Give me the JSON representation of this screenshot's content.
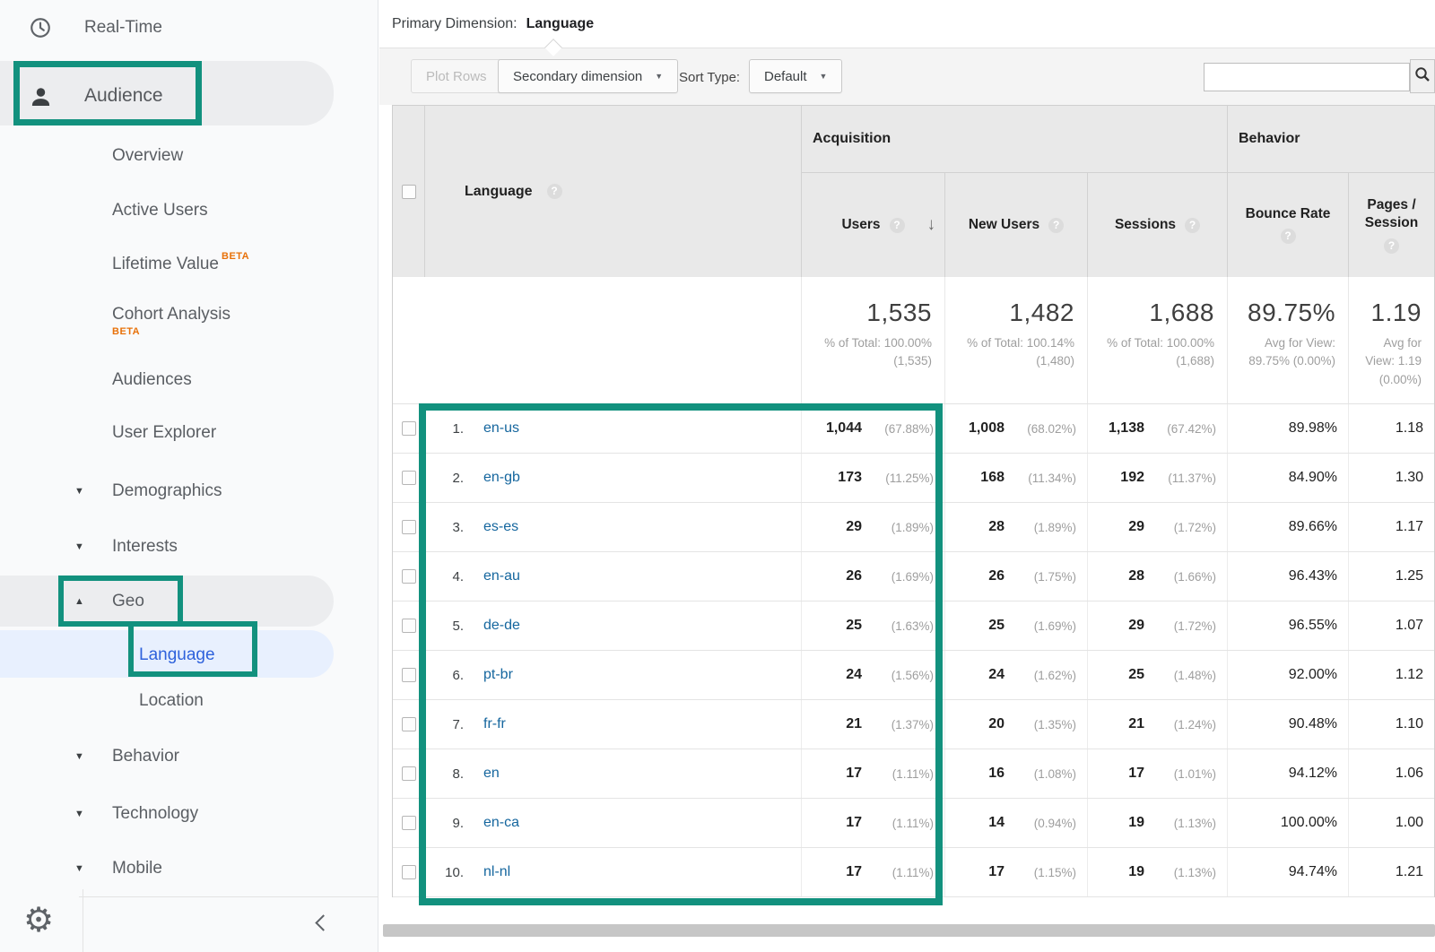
{
  "annotation": {
    "color": "#12917E"
  },
  "sidebar": {
    "real_time": "Real-Time",
    "audience": "Audience",
    "overview": "Overview",
    "active_users": "Active Users",
    "lifetime_value": "Lifetime Value",
    "beta": "BETA",
    "cohort_analysis": "Cohort Analysis",
    "audiences": "Audiences",
    "user_explorer": "User Explorer",
    "demographics": "Demographics",
    "interests": "Interests",
    "geo": "Geo",
    "language": "Language",
    "location": "Location",
    "behavior": "Behavior",
    "technology": "Technology",
    "mobile": "Mobile",
    "arrow_down": "▼",
    "arrow_up": "▲"
  },
  "header": {
    "primary_dimension_label": "Primary Dimension:",
    "primary_dimension_value": "Language"
  },
  "toolbar": {
    "plot_rows": "Plot Rows",
    "secondary_dimension": "Secondary dimension",
    "sort_type_label": "Sort Type:",
    "sort_type_value": "Default",
    "search_value": ""
  },
  "table": {
    "group_acquisition": "Acquisition",
    "group_behavior": "Behavior",
    "col_language": "Language",
    "col_users": "Users",
    "col_new_users": "New Users",
    "col_sessions": "Sessions",
    "col_bounce": "Bounce Rate",
    "col_pages": "Pages / Session",
    "help_glyph": "?",
    "sort_arrow": "↓",
    "summary": {
      "users": "1,535",
      "users_sub": "% of Total: 100.00% (1,535)",
      "new_users": "1,482",
      "new_users_sub": "% of Total: 100.14% (1,480)",
      "sessions": "1,688",
      "sessions_sub": "% of Total: 100.00% (1,688)",
      "bounce": "89.75%",
      "bounce_sub": "Avg for View: 89.75% (0.00%)",
      "pages": "1.19",
      "pages_sub": "Avg for View: 1.19 (0.00%)"
    },
    "rows": [
      {
        "rank": "1.",
        "language": "en-us",
        "users": "1,044",
        "users_pct": "(67.88%)",
        "new_users": "1,008",
        "new_users_pct": "(68.02%)",
        "sessions": "1,138",
        "sessions_pct": "(67.42%)",
        "bounce": "89.98%",
        "pages": "1.18"
      },
      {
        "rank": "2.",
        "language": "en-gb",
        "users": "173",
        "users_pct": "(11.25%)",
        "new_users": "168",
        "new_users_pct": "(11.34%)",
        "sessions": "192",
        "sessions_pct": "(11.37%)",
        "bounce": "84.90%",
        "pages": "1.30"
      },
      {
        "rank": "3.",
        "language": "es-es",
        "users": "29",
        "users_pct": "(1.89%)",
        "new_users": "28",
        "new_users_pct": "(1.89%)",
        "sessions": "29",
        "sessions_pct": "(1.72%)",
        "bounce": "89.66%",
        "pages": "1.17"
      },
      {
        "rank": "4.",
        "language": "en-au",
        "users": "26",
        "users_pct": "(1.69%)",
        "new_users": "26",
        "new_users_pct": "(1.75%)",
        "sessions": "28",
        "sessions_pct": "(1.66%)",
        "bounce": "96.43%",
        "pages": "1.25"
      },
      {
        "rank": "5.",
        "language": "de-de",
        "users": "25",
        "users_pct": "(1.63%)",
        "new_users": "25",
        "new_users_pct": "(1.69%)",
        "sessions": "29",
        "sessions_pct": "(1.72%)",
        "bounce": "96.55%",
        "pages": "1.07"
      },
      {
        "rank": "6.",
        "language": "pt-br",
        "users": "24",
        "users_pct": "(1.56%)",
        "new_users": "24",
        "new_users_pct": "(1.62%)",
        "sessions": "25",
        "sessions_pct": "(1.48%)",
        "bounce": "92.00%",
        "pages": "1.12"
      },
      {
        "rank": "7.",
        "language": "fr-fr",
        "users": "21",
        "users_pct": "(1.37%)",
        "new_users": "20",
        "new_users_pct": "(1.35%)",
        "sessions": "21",
        "sessions_pct": "(1.24%)",
        "bounce": "90.48%",
        "pages": "1.10"
      },
      {
        "rank": "8.",
        "language": "en",
        "users": "17",
        "users_pct": "(1.11%)",
        "new_users": "16",
        "new_users_pct": "(1.08%)",
        "sessions": "17",
        "sessions_pct": "(1.01%)",
        "bounce": "94.12%",
        "pages": "1.06"
      },
      {
        "rank": "9.",
        "language": "en-ca",
        "users": "17",
        "users_pct": "(1.11%)",
        "new_users": "14",
        "new_users_pct": "(0.94%)",
        "sessions": "19",
        "sessions_pct": "(1.13%)",
        "bounce": "100.00%",
        "pages": "1.00"
      },
      {
        "rank": "10.",
        "language": "nl-nl",
        "users": "17",
        "users_pct": "(1.11%)",
        "new_users": "17",
        "new_users_pct": "(1.15%)",
        "sessions": "19",
        "sessions_pct": "(1.13%)",
        "bounce": "94.74%",
        "pages": "1.21"
      }
    ]
  }
}
